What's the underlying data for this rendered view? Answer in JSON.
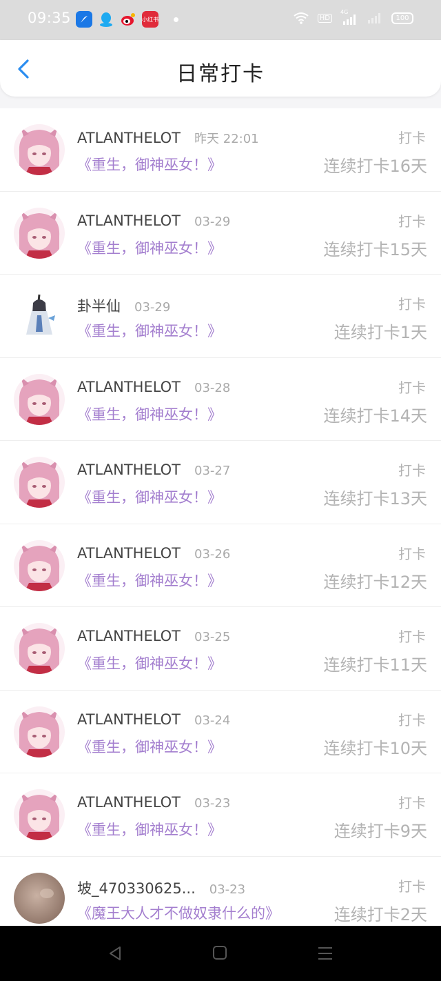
{
  "status_bar": {
    "time": "09:35",
    "apps": [
      {
        "icon": "feather-app-icon",
        "label": ""
      },
      {
        "icon": "qq-icon",
        "label": ""
      },
      {
        "icon": "weibo-icon",
        "label": ""
      },
      {
        "icon": "redbook-icon",
        "label": "小红书"
      }
    ],
    "hd_label": "HD",
    "network_label": "4G",
    "battery": "100"
  },
  "header": {
    "title": "日常打卡",
    "back_icon": "chevron-left-icon",
    "accent_color": "#2a8df0"
  },
  "entries": [
    {
      "avatar": "pink-hair-avatar",
      "user": "ATLANTHELOT",
      "date": "昨天 22:01",
      "book": "《重生，御神巫女！》",
      "action": "打卡",
      "streak": "连续打卡16天"
    },
    {
      "avatar": "pink-hair-avatar",
      "user": "ATLANTHELOT",
      "date": "03-29",
      "book": "《重生，御神巫女！》",
      "action": "打卡",
      "streak": "连续打卡15天"
    },
    {
      "avatar": "sage-character-avatar",
      "user": "卦半仙",
      "date": "03-29",
      "book": "《重生，御神巫女！》",
      "action": "打卡",
      "streak": "连续打卡1天"
    },
    {
      "avatar": "pink-hair-avatar",
      "user": "ATLANTHELOT",
      "date": "03-28",
      "book": "《重生，御神巫女！》",
      "action": "打卡",
      "streak": "连续打卡14天"
    },
    {
      "avatar": "pink-hair-avatar",
      "user": "ATLANTHELOT",
      "date": "03-27",
      "book": "《重生，御神巫女！》",
      "action": "打卡",
      "streak": "连续打卡13天"
    },
    {
      "avatar": "pink-hair-avatar",
      "user": "ATLANTHELOT",
      "date": "03-26",
      "book": "《重生，御神巫女！》",
      "action": "打卡",
      "streak": "连续打卡12天"
    },
    {
      "avatar": "pink-hair-avatar",
      "user": "ATLANTHELOT",
      "date": "03-25",
      "book": "《重生，御神巫女！》",
      "action": "打卡",
      "streak": "连续打卡11天"
    },
    {
      "avatar": "pink-hair-avatar",
      "user": "ATLANTHELOT",
      "date": "03-24",
      "book": "《重生，御神巫女！》",
      "action": "打卡",
      "streak": "连续打卡10天"
    },
    {
      "avatar": "pink-hair-avatar",
      "user": "ATLANTHELOT",
      "date": "03-23",
      "book": "《重生，御神巫女！》",
      "action": "打卡",
      "streak": "连续打卡9天"
    },
    {
      "avatar": "blurred-photo-avatar",
      "user": "坡_470330625...",
      "date": "03-23",
      "book": "《魔王大人才不做奴隶什么的》",
      "action": "打卡",
      "streak": "连续打卡2天"
    }
  ],
  "colors": {
    "book_title": "#a47fcf",
    "muted": "#b3b3b3",
    "status_bar_bg": "#dcdcdc"
  },
  "nav_bar": {
    "back_icon": "triangle-back-icon",
    "home_icon": "square-home-icon",
    "menu_icon": "three-lines-menu-icon"
  }
}
